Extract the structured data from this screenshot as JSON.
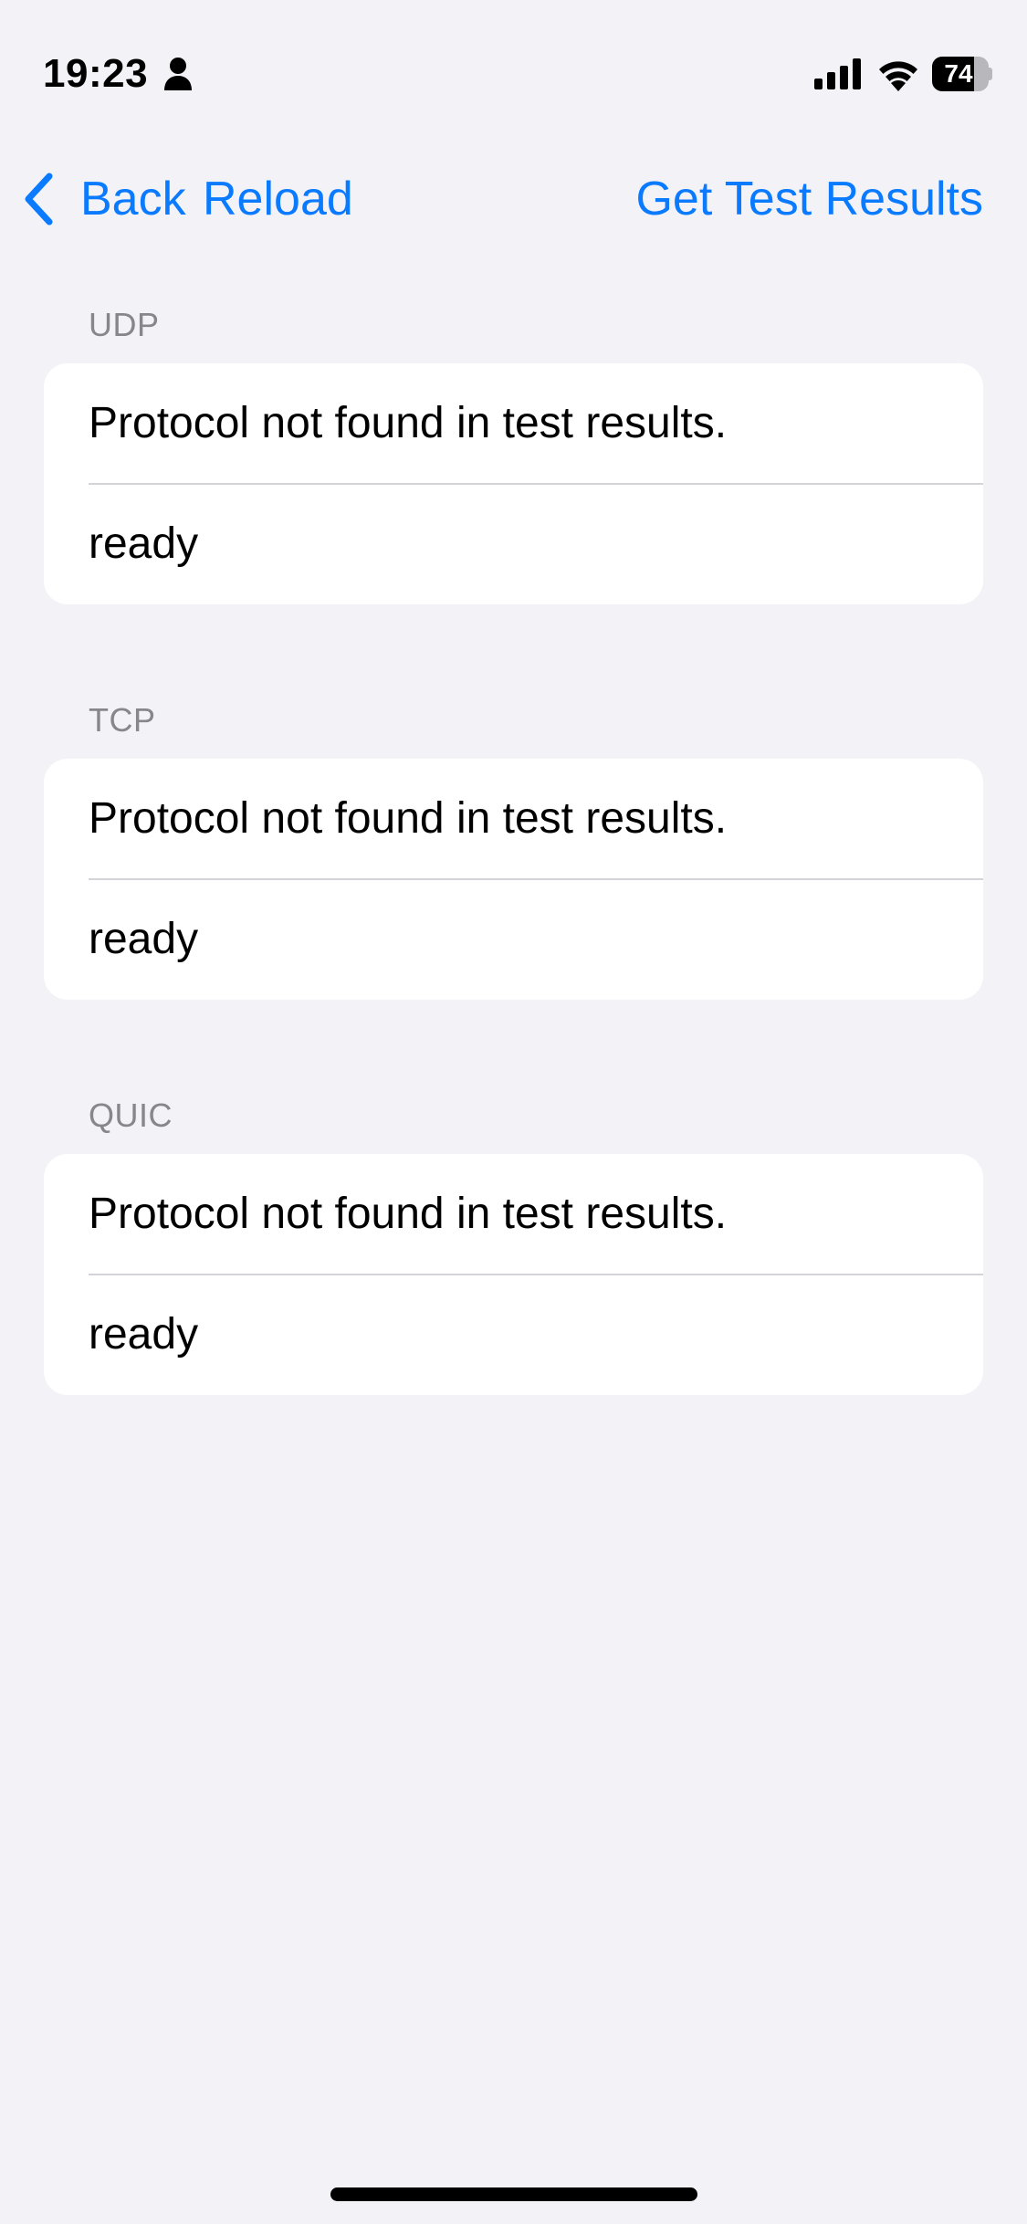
{
  "status_bar": {
    "time": "19:23",
    "battery_percent": "74",
    "battery_level": 0.74,
    "icons": [
      "person-icon",
      "signal-icon",
      "wifi-icon",
      "battery-icon"
    ]
  },
  "nav": {
    "back_label": "Back",
    "reload_label": "Reload",
    "get_results_label": "Get Test Results",
    "accent_color": "#0a7aff"
  },
  "sections": [
    {
      "header": "UDP",
      "rows": [
        "Protocol not found in test results.",
        "ready"
      ]
    },
    {
      "header": "TCP",
      "rows": [
        "Protocol not found in test results.",
        "ready"
      ]
    },
    {
      "header": "QUIC",
      "rows": [
        "Protocol not found in test results.",
        "ready"
      ]
    }
  ],
  "colors": {
    "background": "#f2f2f7",
    "card": "#ffffff",
    "section_header": "#86868b"
  }
}
